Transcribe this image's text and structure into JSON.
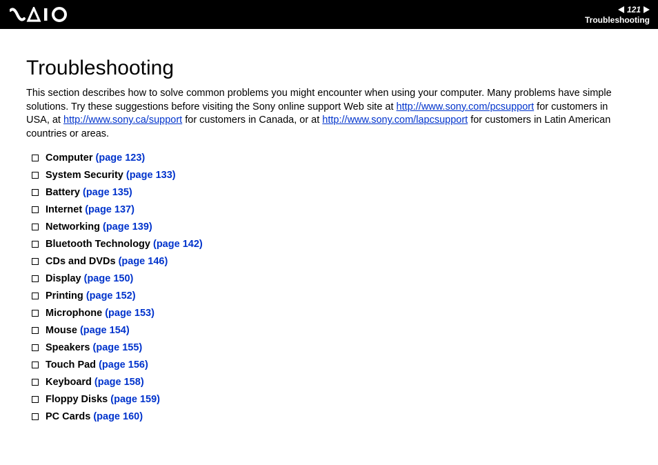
{
  "header": {
    "brand": "VAIO",
    "page_number": "121",
    "section": "Troubleshooting"
  },
  "title": "Troubleshooting",
  "intro": {
    "t1": "This section describes how to solve common problems you might encounter when using your computer. Many problems have simple solutions. Try these suggestions before visiting the Sony online support Web site at ",
    "link1": "http://www.sony.com/pcsupport",
    "t2": " for customers in USA, at ",
    "link2": "http://www.sony.ca/support",
    "t3": " for customers in Canada, or at ",
    "link3": "http://www.sony.com/lapcsupport",
    "t4": " for customers in Latin American countries or areas."
  },
  "toc": [
    {
      "label": "Computer",
      "page": "(page 123)"
    },
    {
      "label": "System Security",
      "page": "(page 133)"
    },
    {
      "label": "Battery",
      "page": "(page 135)"
    },
    {
      "label": "Internet",
      "page": "(page 137)"
    },
    {
      "label": "Networking",
      "page": "(page 139)"
    },
    {
      "label": "Bluetooth Technology",
      "page": "(page 142)"
    },
    {
      "label": "CDs and DVDs",
      "page": "(page 146)"
    },
    {
      "label": "Display",
      "page": "(page 150)"
    },
    {
      "label": "Printing",
      "page": "(page 152)"
    },
    {
      "label": "Microphone",
      "page": "(page 153)"
    },
    {
      "label": "Mouse",
      "page": "(page 154)"
    },
    {
      "label": "Speakers",
      "page": "(page 155)"
    },
    {
      "label": "Touch Pad",
      "page": "(page 156)"
    },
    {
      "label": "Keyboard",
      "page": "(page 158)"
    },
    {
      "label": "Floppy Disks",
      "page": "(page 159)"
    },
    {
      "label": "PC Cards",
      "page": "(page 160)"
    }
  ]
}
